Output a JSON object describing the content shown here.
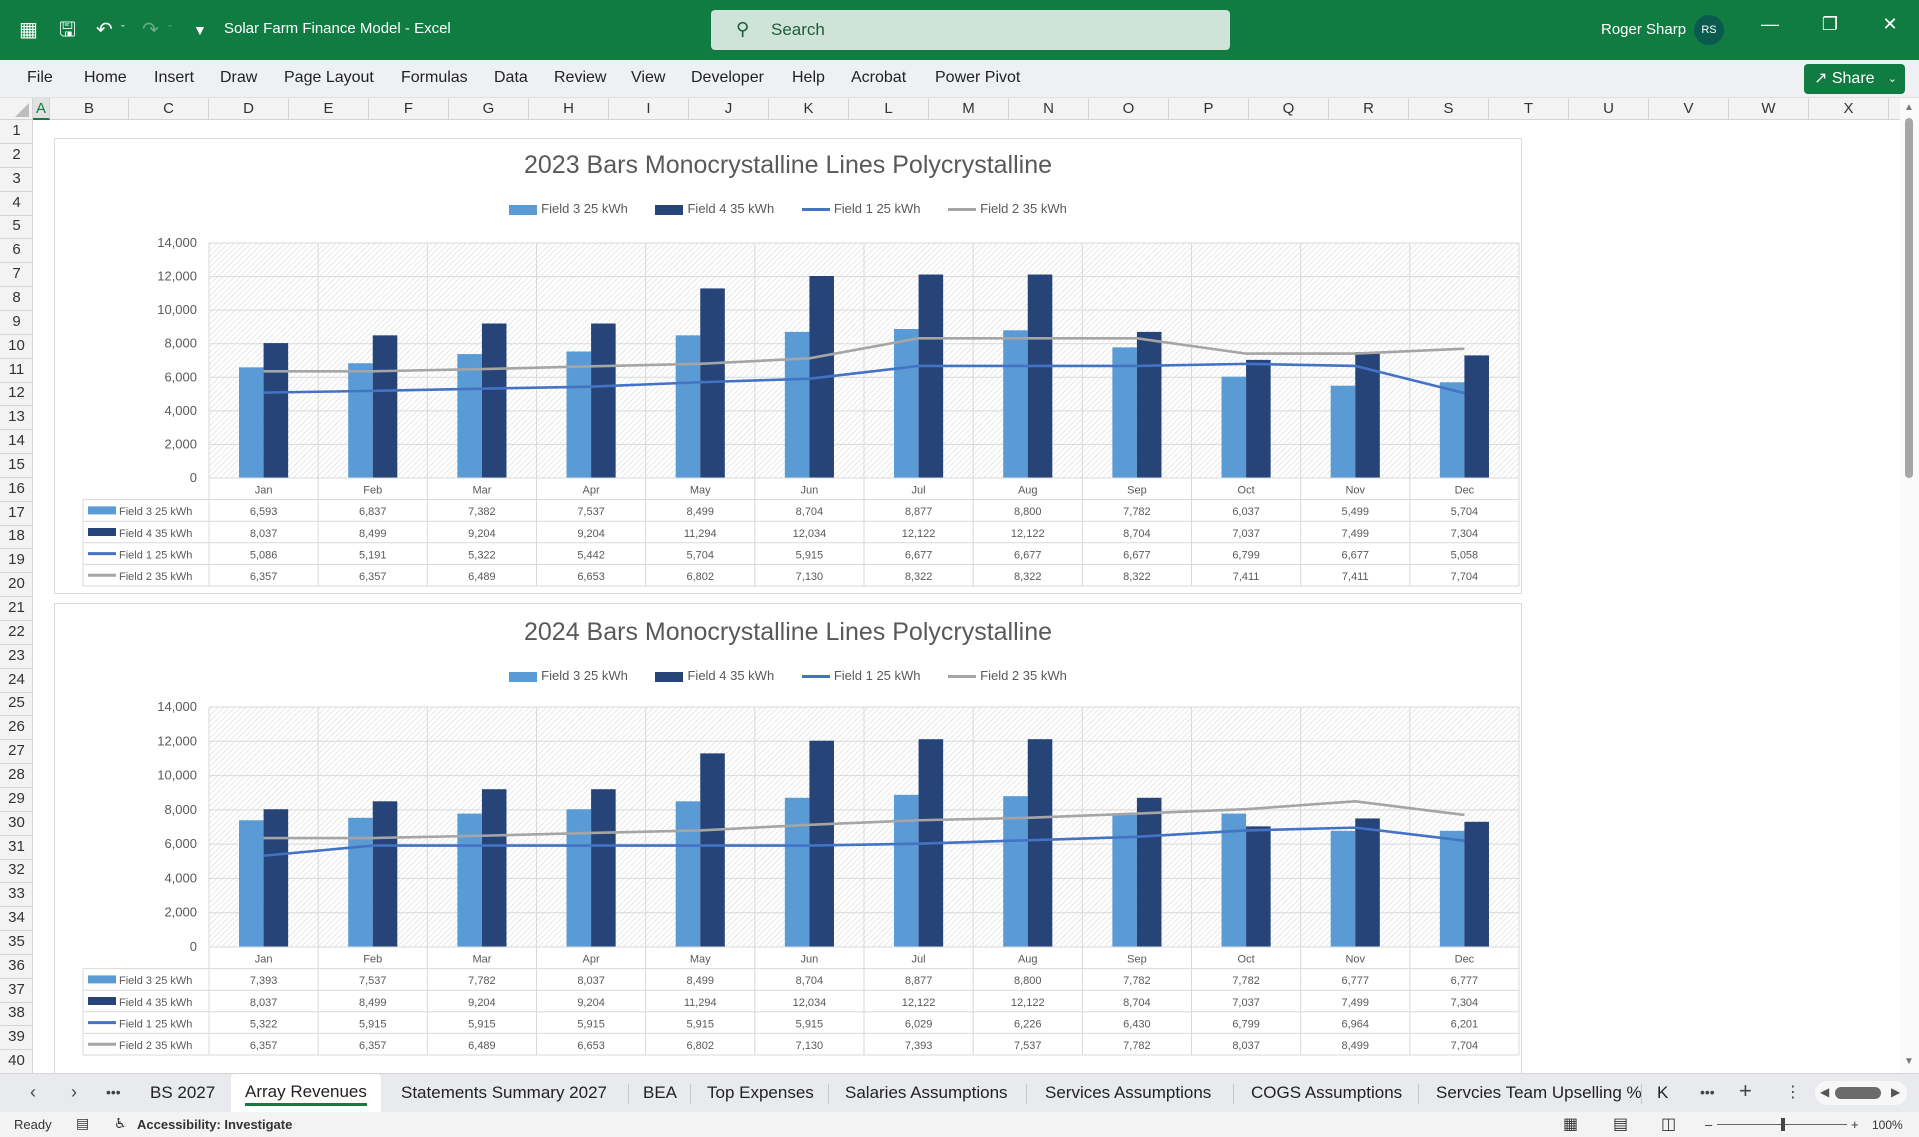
{
  "titlebar": {
    "doc_title": "Solar Farm Finance Model  -  Excel",
    "search_placeholder": "Search",
    "user_name": "Roger Sharp",
    "user_initials": "RS",
    "icons": [
      "excel-logo-icon",
      "save-icon",
      "undo-icon",
      "redo-icon",
      "customize-qat-icon",
      "minimize-icon",
      "restore-icon",
      "close-icon"
    ]
  },
  "ribbon": {
    "tabs": [
      "File",
      "Home",
      "Insert",
      "Draw",
      "Page Layout",
      "Formulas",
      "Data",
      "Review",
      "View",
      "Developer",
      "Help",
      "Acrobat",
      "Power Pivot"
    ],
    "share_label": "Share"
  },
  "grid": {
    "columns": [
      "A",
      "B",
      "C",
      "D",
      "E",
      "F",
      "G",
      "H",
      "I",
      "J",
      "K",
      "L",
      "M",
      "N",
      "O",
      "P",
      "Q",
      "R",
      "S",
      "T",
      "U",
      "V",
      "W",
      "X"
    ],
    "selected_column": "A",
    "rows": [
      "1",
      "2",
      "3",
      "4",
      "5",
      "6",
      "7",
      "8",
      "9",
      "10",
      "11",
      "12",
      "13",
      "14",
      "15",
      "16",
      "17",
      "18",
      "19",
      "20",
      "21",
      "22",
      "23",
      "24",
      "25",
      "26",
      "27",
      "28",
      "29",
      "30",
      "31",
      "32",
      "33",
      "34",
      "35",
      "36",
      "37",
      "38",
      "39",
      "40"
    ]
  },
  "colors": {
    "excel_green": "#107c41",
    "field3": "#5b9bd5",
    "field4": "#264478",
    "field1": "#4472c4",
    "field2": "#a5a5a5"
  },
  "chart_data": [
    {
      "type": "bar",
      "title": "2023 Bars Monocrystalline Lines Polycrystalline",
      "categories": [
        "Jan",
        "Feb",
        "Mar",
        "Apr",
        "May",
        "Jun",
        "Jul",
        "Aug",
        "Sep",
        "Oct",
        "Nov",
        "Dec"
      ],
      "ylim": [
        0,
        14000
      ],
      "yticks": [
        "0",
        "2,000",
        "4,000",
        "6,000",
        "8,000",
        "10,000",
        "12,000",
        "14,000"
      ],
      "grid": true,
      "legend": "top",
      "data_table": true,
      "series": [
        {
          "name": "Field 3 25 kWh",
          "kind": "bar",
          "values": [
            6593,
            6837,
            7382,
            7537,
            8499,
            8704,
            8877,
            8800,
            7782,
            6037,
            5499,
            5704
          ],
          "labels": [
            "6,593",
            "6,837",
            "7,382",
            "7,537",
            "8,499",
            "8,704",
            "8,877",
            "8,800",
            "7,782",
            "6,037",
            "5,499",
            "5,704"
          ]
        },
        {
          "name": "Field 4 35 kWh",
          "kind": "bar",
          "values": [
            8037,
            8499,
            9204,
            9204,
            11294,
            12034,
            12122,
            12122,
            8704,
            7037,
            7499,
            7304
          ],
          "labels": [
            "8,037",
            "8,499",
            "9,204",
            "9,204",
            "11,294",
            "12,034",
            "12,122",
            "12,122",
            "8,704",
            "7,037",
            "7,499",
            "7,304"
          ]
        },
        {
          "name": "Field 1 25 kWh",
          "kind": "line",
          "values": [
            5086,
            5191,
            5322,
            5442,
            5704,
            5915,
            6677,
            6677,
            6677,
            6799,
            6677,
            5058
          ],
          "labels": [
            "5,086",
            "5,191",
            "5,322",
            "5,442",
            "5,704",
            "5,915",
            "6,677",
            "6,677",
            "6,677",
            "6,799",
            "6,677",
            "5,058"
          ]
        },
        {
          "name": "Field 2 35 kWh",
          "kind": "line",
          "values": [
            6357,
            6357,
            6489,
            6653,
            6802,
            7130,
            8322,
            8322,
            8322,
            7411,
            7411,
            7704
          ],
          "labels": [
            "6,357",
            "6,357",
            "6,489",
            "6,653",
            "6,802",
            "7,130",
            "8,322",
            "8,322",
            "8,322",
            "7,411",
            "7,411",
            "7,704"
          ]
        }
      ]
    },
    {
      "type": "bar",
      "title": "2024 Bars Monocrystalline Lines Polycrystalline",
      "categories": [
        "Jan",
        "Feb",
        "Mar",
        "Apr",
        "May",
        "Jun",
        "Jul",
        "Aug",
        "Sep",
        "Oct",
        "Nov",
        "Dec"
      ],
      "ylim": [
        0,
        14000
      ],
      "yticks": [
        "0",
        "2,000",
        "4,000",
        "6,000",
        "8,000",
        "10,000",
        "12,000",
        "14,000"
      ],
      "grid": true,
      "legend": "top",
      "data_table": true,
      "series": [
        {
          "name": "Field 3 25 kWh",
          "kind": "bar",
          "values": [
            7393,
            7537,
            7782,
            8037,
            8499,
            8704,
            8877,
            8800,
            7782,
            7782,
            6777,
            6777
          ],
          "labels": [
            "7,393",
            "7,537",
            "7,782",
            "8,037",
            "8,499",
            "8,704",
            "8,877",
            "8,800",
            "7,782",
            "7,782",
            "6,777",
            "6,777"
          ]
        },
        {
          "name": "Field 4 35 kWh",
          "kind": "bar",
          "values": [
            8037,
            8499,
            9204,
            9204,
            11294,
            12034,
            12122,
            12122,
            8704,
            7037,
            7499,
            7304
          ],
          "labels": [
            "8,037",
            "8,499",
            "9,204",
            "9,204",
            "11,294",
            "12,034",
            "12,122",
            "12,122",
            "8,704",
            "7,037",
            "7,499",
            "7,304"
          ]
        },
        {
          "name": "Field 1 25 kWh",
          "kind": "line",
          "values": [
            5322,
            5915,
            5915,
            5915,
            5915,
            5915,
            6029,
            6226,
            6430,
            6799,
            6964,
            6201
          ],
          "labels": [
            "5,322",
            "5,915",
            "5,915",
            "5,915",
            "5,915",
            "5,915",
            "6,029",
            "6,226",
            "6,430",
            "6,799",
            "6,964",
            "6,201"
          ]
        },
        {
          "name": "Field 2 35 kWh",
          "kind": "line",
          "values": [
            6357,
            6357,
            6489,
            6653,
            6802,
            7130,
            7393,
            7537,
            7782,
            8037,
            8499,
            7704
          ],
          "labels": [
            "6,357",
            "6,357",
            "6,489",
            "6,653",
            "6,802",
            "7,130",
            "7,393",
            "7,537",
            "7,782",
            "8,037",
            "8,499",
            "7,704"
          ]
        }
      ]
    }
  ],
  "sheet_tabs": {
    "tabs": [
      "BS 2027",
      "Array Revenues",
      "Statements Summary 2027",
      "BEA",
      "Top Expenses",
      "Salaries Assumptions",
      "Services Assumptions",
      "COGS Assumptions",
      "Servcies Team Upselling %",
      "K"
    ],
    "active": "Array Revenues"
  },
  "statusbar": {
    "ready": "Ready",
    "accessibility": "Accessibility: Investigate",
    "zoom": "100%"
  }
}
